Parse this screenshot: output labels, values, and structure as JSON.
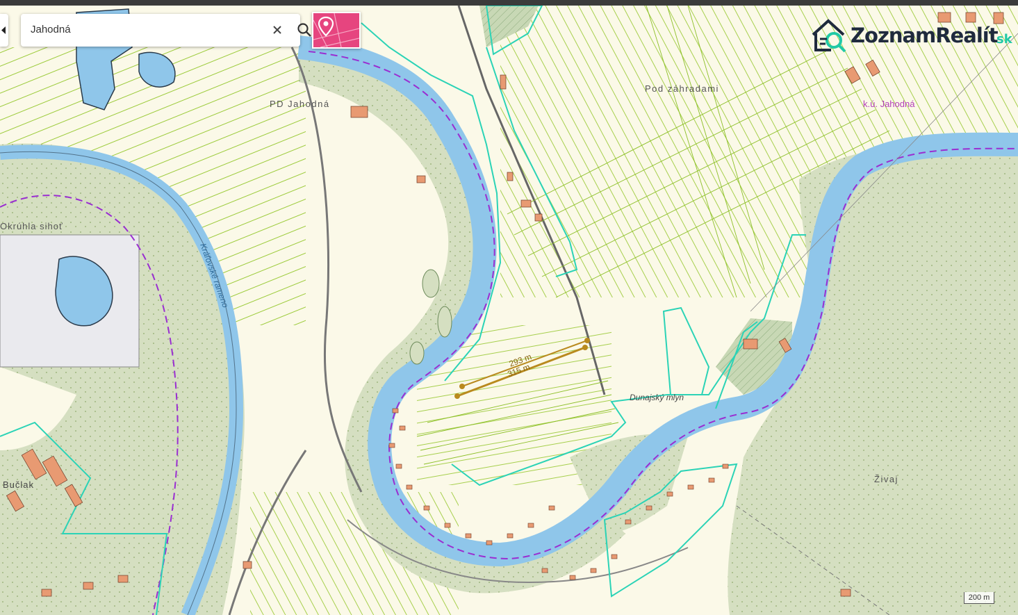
{
  "search": {
    "query": "Jahodná"
  },
  "icons": {
    "back": "chevron-left-icon",
    "clear": "close-icon",
    "search": "search-icon",
    "pin": "location-pin-icon",
    "logo": "house-magnifier-icon"
  },
  "brand": {
    "name": "ZoznamRealít",
    "suffix": "sk"
  },
  "map": {
    "labels": {
      "pd_jahodna": "PD Jahodná",
      "pod_zahradami": "Pod záhradami",
      "ku_jahodna": "k.ú. Jahodná",
      "okruhla_sihot": "Okrúhla sihoť",
      "kralovske_rameno": "Kráľovské rameno",
      "dunajsky_mlyn": "Dunajský mlyn",
      "zivaj": "Živaj",
      "bucuak": "Bučlak"
    },
    "measure": {
      "a": "293 m",
      "b": "315 m"
    },
    "scale": "200 m"
  },
  "colors": {
    "water": "#8fc6ea",
    "forest": "#d5dfc1",
    "fields": "#fbf9e8",
    "parcel_lines": "#8cbf26",
    "boundary": "#2bd3b6",
    "cadastral_border": "#9a2ed1",
    "buildings": "#e89a72",
    "measure": "#b98a1e",
    "accent": "#e6457f"
  }
}
